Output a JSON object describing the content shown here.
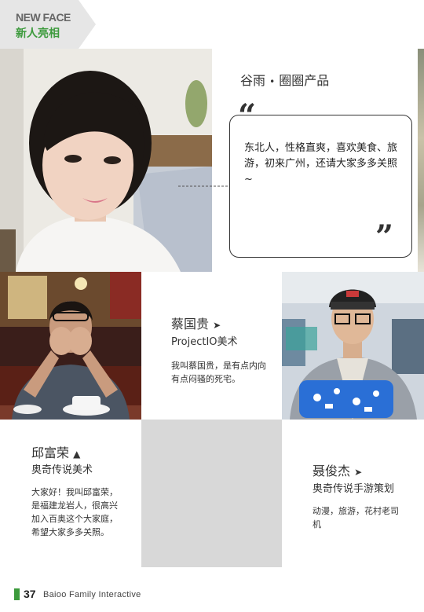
{
  "header": {
    "en": "NEW FACE",
    "cn": "新人亮相"
  },
  "person1": {
    "name": "谷雨",
    "sep": "•",
    "role": "圈圈产品",
    "bio": "东北人，性格直爽，喜欢美食、旅游，初来广州，还请大家多多关照~"
  },
  "person2": {
    "name": "蔡国贵",
    "arrow": "➤",
    "role": "ProjectIO美术",
    "bio": "我叫蔡国贵，是有点内向有点闷骚的死宅。"
  },
  "person3": {
    "name": "邱富荣",
    "arrow": "▲",
    "role": "奥奇传说美术",
    "bio": "大家好！我叫邱富荣，是福建龙岩人，很高兴加入百奥这个大家庭，希望大家多多关照。"
  },
  "person4": {
    "name": "聂俊杰",
    "arrow": "➤",
    "role": "奥奇传说手游策划",
    "bio": "动漫，旅游，花村老司机"
  },
  "footer": {
    "page": "37",
    "text": "Baioo Family Interactive"
  },
  "colors": {
    "accent": "#3c9a3c",
    "grey_block": "#d8d8d8"
  }
}
